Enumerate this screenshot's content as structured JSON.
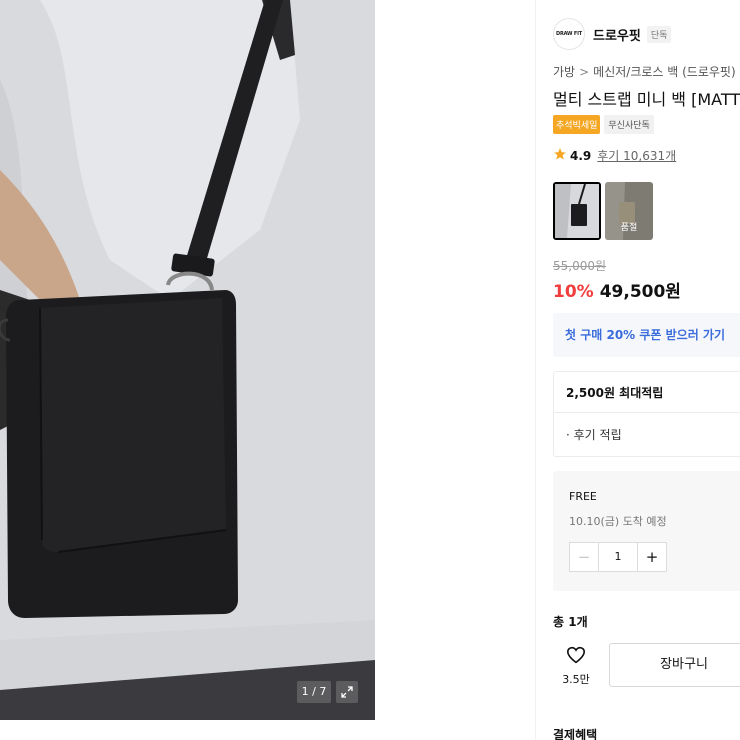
{
  "gallery": {
    "counter": "1 / 7"
  },
  "brand": {
    "logo_text": "DRAW FIT",
    "name": "드로우핏",
    "tag": "단독"
  },
  "breadcrumb": [
    "가방",
    "메신저/크로스 백 (드로우핏)"
  ],
  "breadcrumb_sep": ">",
  "product": {
    "title": "멀티 스트랩 미니 백 [MATT"
  },
  "tags": {
    "event": "추석빅세일",
    "exclusive": "무신사단독"
  },
  "rating": {
    "score": "4.9",
    "reviews": "후기 10,631개"
  },
  "thumbnails": [
    {
      "label": ""
    },
    {
      "label": "품절"
    }
  ],
  "price": {
    "original": "55,000원",
    "discount": "10%",
    "final": "49,500원"
  },
  "coupon": {
    "text": "첫 구매 20% 쿠폰 받으러 가기"
  },
  "points": {
    "max": "2,500원 최대적립",
    "review": "· 후기 적립"
  },
  "option": {
    "shipping": "FREE",
    "arrival": "10.10(금) 도착 예정",
    "quantity": "1",
    "minus": "−",
    "plus": "+"
  },
  "summary": {
    "total": "총 1개",
    "likes": "3.5만",
    "cart_label": "장바구니",
    "benefit_heading": "결제혜택"
  },
  "icons": {
    "star": "star-icon",
    "heart": "heart-icon",
    "expand": "expand-icon"
  },
  "colors": {
    "discount": "#f03d3d",
    "coupon_text": "#3b6cdb",
    "event_tag": "#f5a623",
    "star": "#f5a623"
  }
}
